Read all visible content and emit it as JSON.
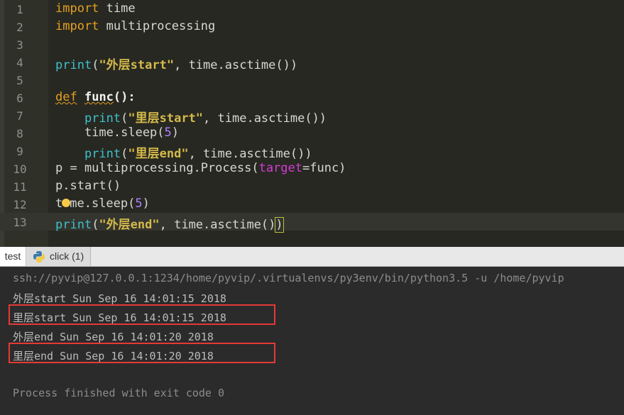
{
  "editor": {
    "line_numbers": [
      "1",
      "2",
      "3",
      "4",
      "5",
      "6",
      "7",
      "8",
      "9",
      "10",
      "11",
      "12",
      "13"
    ],
    "lines": {
      "l1": [
        "import",
        " time"
      ],
      "l2": [
        "import",
        " multiprocessing"
      ],
      "l4": [
        "print",
        "(",
        "\"外层start\"",
        ", time.asctime())"
      ],
      "l6": [
        "def",
        " ",
        "func",
        "():"
      ],
      "l7": [
        "    ",
        "print",
        "(",
        "\"里层start\"",
        ", time.asctime())"
      ],
      "l8": [
        "    time.sleep(",
        "5",
        ")"
      ],
      "l9": [
        "    ",
        "print",
        "(",
        "\"里层end\"",
        ", time.asctime())"
      ],
      "l10": [
        "p = multiprocessing.Process(",
        "target",
        "=func)"
      ],
      "l11": [
        "p.start()"
      ],
      "l12": [
        "t",
        "me.sleep(",
        "5",
        ")"
      ],
      "l13": [
        "print",
        "(",
        "\"外层end\"",
        ", time.asctime()",
        ")"
      ]
    }
  },
  "tabs": {
    "test_label": "test",
    "click_label": "click (1)"
  },
  "console": {
    "command": "ssh://pyvip@127.0.0.1:1234/home/pyvip/.virtualenvs/py3env/bin/python3.5 -u /home/pyvip",
    "out1": "外层start Sun Sep 16 14:01:15 2018",
    "out2": "里层start Sun Sep 16 14:01:15 2018",
    "out3": "外层end Sun Sep 16 14:01:20 2018",
    "out4": "里层end Sun Sep 16 14:01:20 2018",
    "exit": "Process finished with exit code 0"
  },
  "colors": {
    "highlight_box": "#e53935",
    "keyword": "#e6a020",
    "builtin": "#3fc1c9",
    "string": "#d4b94a"
  }
}
